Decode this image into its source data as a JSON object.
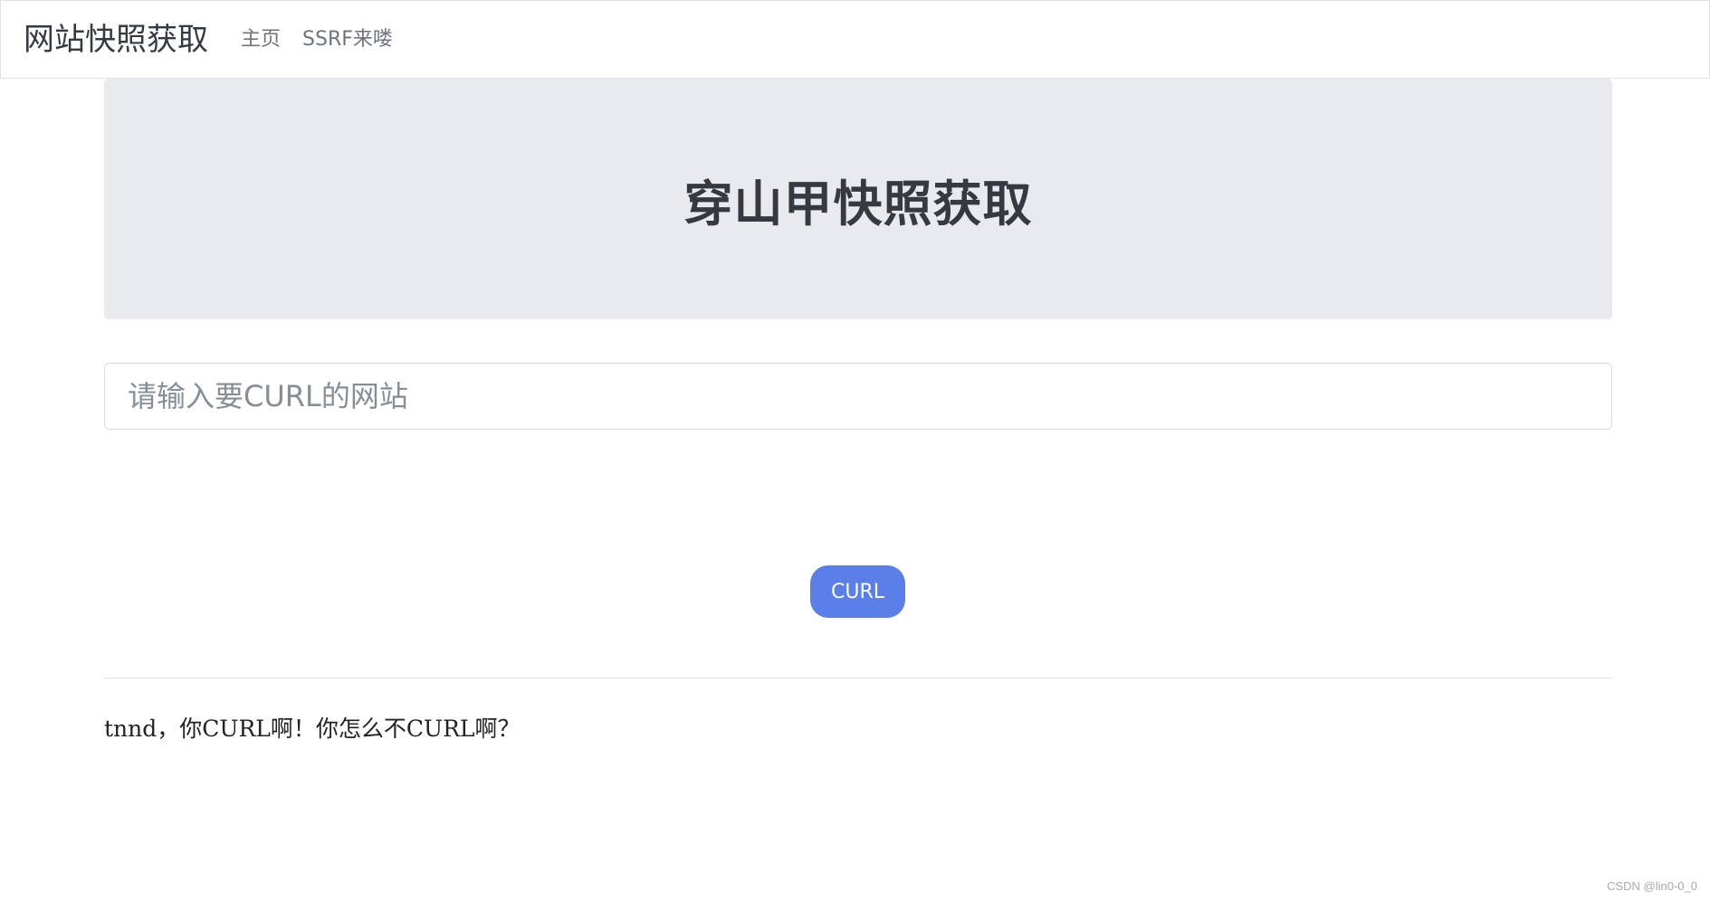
{
  "navbar": {
    "brand": "网站快照获取",
    "links": [
      {
        "label": "主页"
      },
      {
        "label": "SSRF来喽"
      }
    ]
  },
  "jumbotron": {
    "title": "穿山甲快照获取"
  },
  "form": {
    "url_input": {
      "placeholder": "请输入要CURL的网站",
      "value": ""
    },
    "submit_label": "CURL"
  },
  "result": {
    "text": "tnnd，你CURL啊！你怎么不CURL啊？"
  },
  "watermark": {
    "text": "CSDN @lin0-0_0"
  },
  "colors": {
    "button_bg": "#5b7fe8",
    "jumbotron_bg": "#e9eaee",
    "title_text": "#343a40",
    "nav_link": "#6c757d"
  }
}
